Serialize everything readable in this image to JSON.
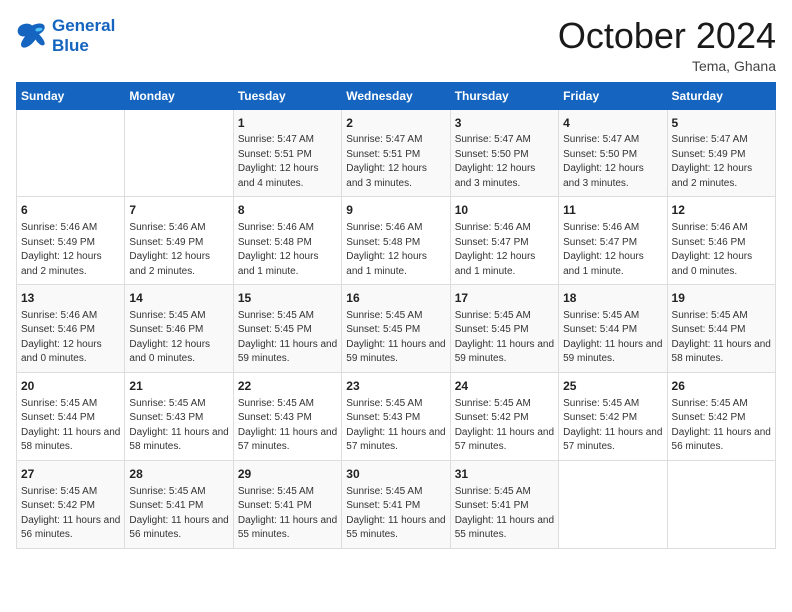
{
  "header": {
    "logo_line1": "General",
    "logo_line2": "Blue",
    "month": "October 2024",
    "location": "Tema, Ghana"
  },
  "days_of_week": [
    "Sunday",
    "Monday",
    "Tuesday",
    "Wednesday",
    "Thursday",
    "Friday",
    "Saturday"
  ],
  "weeks": [
    [
      {
        "day": null,
        "content": ""
      },
      {
        "day": null,
        "content": ""
      },
      {
        "day": "1",
        "content": "Sunrise: 5:47 AM\nSunset: 5:51 PM\nDaylight: 12 hours and 4 minutes."
      },
      {
        "day": "2",
        "content": "Sunrise: 5:47 AM\nSunset: 5:51 PM\nDaylight: 12 hours and 3 minutes."
      },
      {
        "day": "3",
        "content": "Sunrise: 5:47 AM\nSunset: 5:50 PM\nDaylight: 12 hours and 3 minutes."
      },
      {
        "day": "4",
        "content": "Sunrise: 5:47 AM\nSunset: 5:50 PM\nDaylight: 12 hours and 3 minutes."
      },
      {
        "day": "5",
        "content": "Sunrise: 5:47 AM\nSunset: 5:49 PM\nDaylight: 12 hours and 2 minutes."
      }
    ],
    [
      {
        "day": "6",
        "content": "Sunrise: 5:46 AM\nSunset: 5:49 PM\nDaylight: 12 hours and 2 minutes."
      },
      {
        "day": "7",
        "content": "Sunrise: 5:46 AM\nSunset: 5:49 PM\nDaylight: 12 hours and 2 minutes."
      },
      {
        "day": "8",
        "content": "Sunrise: 5:46 AM\nSunset: 5:48 PM\nDaylight: 12 hours and 1 minute."
      },
      {
        "day": "9",
        "content": "Sunrise: 5:46 AM\nSunset: 5:48 PM\nDaylight: 12 hours and 1 minute."
      },
      {
        "day": "10",
        "content": "Sunrise: 5:46 AM\nSunset: 5:47 PM\nDaylight: 12 hours and 1 minute."
      },
      {
        "day": "11",
        "content": "Sunrise: 5:46 AM\nSunset: 5:47 PM\nDaylight: 12 hours and 1 minute."
      },
      {
        "day": "12",
        "content": "Sunrise: 5:46 AM\nSunset: 5:46 PM\nDaylight: 12 hours and 0 minutes."
      }
    ],
    [
      {
        "day": "13",
        "content": "Sunrise: 5:46 AM\nSunset: 5:46 PM\nDaylight: 12 hours and 0 minutes."
      },
      {
        "day": "14",
        "content": "Sunrise: 5:45 AM\nSunset: 5:46 PM\nDaylight: 12 hours and 0 minutes."
      },
      {
        "day": "15",
        "content": "Sunrise: 5:45 AM\nSunset: 5:45 PM\nDaylight: 11 hours and 59 minutes."
      },
      {
        "day": "16",
        "content": "Sunrise: 5:45 AM\nSunset: 5:45 PM\nDaylight: 11 hours and 59 minutes."
      },
      {
        "day": "17",
        "content": "Sunrise: 5:45 AM\nSunset: 5:45 PM\nDaylight: 11 hours and 59 minutes."
      },
      {
        "day": "18",
        "content": "Sunrise: 5:45 AM\nSunset: 5:44 PM\nDaylight: 11 hours and 59 minutes."
      },
      {
        "day": "19",
        "content": "Sunrise: 5:45 AM\nSunset: 5:44 PM\nDaylight: 11 hours and 58 minutes."
      }
    ],
    [
      {
        "day": "20",
        "content": "Sunrise: 5:45 AM\nSunset: 5:44 PM\nDaylight: 11 hours and 58 minutes."
      },
      {
        "day": "21",
        "content": "Sunrise: 5:45 AM\nSunset: 5:43 PM\nDaylight: 11 hours and 58 minutes."
      },
      {
        "day": "22",
        "content": "Sunrise: 5:45 AM\nSunset: 5:43 PM\nDaylight: 11 hours and 57 minutes."
      },
      {
        "day": "23",
        "content": "Sunrise: 5:45 AM\nSunset: 5:43 PM\nDaylight: 11 hours and 57 minutes."
      },
      {
        "day": "24",
        "content": "Sunrise: 5:45 AM\nSunset: 5:42 PM\nDaylight: 11 hours and 57 minutes."
      },
      {
        "day": "25",
        "content": "Sunrise: 5:45 AM\nSunset: 5:42 PM\nDaylight: 11 hours and 57 minutes."
      },
      {
        "day": "26",
        "content": "Sunrise: 5:45 AM\nSunset: 5:42 PM\nDaylight: 11 hours and 56 minutes."
      }
    ],
    [
      {
        "day": "27",
        "content": "Sunrise: 5:45 AM\nSunset: 5:42 PM\nDaylight: 11 hours and 56 minutes."
      },
      {
        "day": "28",
        "content": "Sunrise: 5:45 AM\nSunset: 5:41 PM\nDaylight: 11 hours and 56 minutes."
      },
      {
        "day": "29",
        "content": "Sunrise: 5:45 AM\nSunset: 5:41 PM\nDaylight: 11 hours and 55 minutes."
      },
      {
        "day": "30",
        "content": "Sunrise: 5:45 AM\nSunset: 5:41 PM\nDaylight: 11 hours and 55 minutes."
      },
      {
        "day": "31",
        "content": "Sunrise: 5:45 AM\nSunset: 5:41 PM\nDaylight: 11 hours and 55 minutes."
      },
      {
        "day": null,
        "content": ""
      },
      {
        "day": null,
        "content": ""
      }
    ]
  ]
}
